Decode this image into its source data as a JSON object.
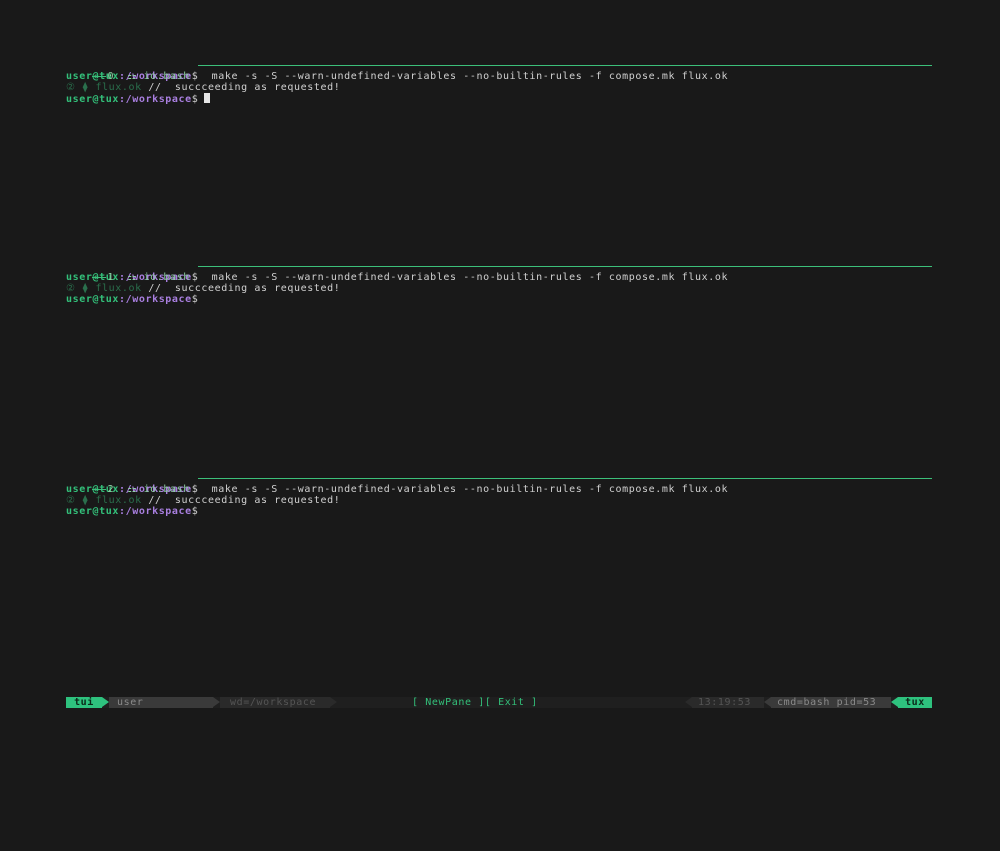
{
  "panes": [
    {
      "index": "0",
      "name": "io.bash",
      "prompt_user": "user@tux",
      "prompt_path": ":/workspace",
      "prompt_sym": "$",
      "command": "  make -s -S --warn-undefined-variables --no-builtin-rules -f compose.mk flux.ok",
      "out_marker": "② ⧫ ",
      "out_target": "flux.ok",
      "out_msg": " //  succceeding as requested!",
      "active": true
    },
    {
      "index": "1",
      "name": "io.bash",
      "prompt_user": "user@tux",
      "prompt_path": ":/workspace",
      "prompt_sym": "$",
      "command": "  make -s -S --warn-undefined-variables --no-builtin-rules -f compose.mk flux.ok",
      "out_marker": "② ⧫ ",
      "out_target": "flux.ok",
      "out_msg": " //  succceeding as requested!",
      "active": false
    },
    {
      "index": "2",
      "name": "io.bash",
      "prompt_user": "user@tux",
      "prompt_path": ":/workspace",
      "prompt_sym": "$",
      "command": "  make -s -S --warn-undefined-variables --no-builtin-rules -f compose.mk flux.ok",
      "out_marker": "② ⧫ ",
      "out_target": "flux.ok",
      "out_msg": " //  succceeding as requested!",
      "active": false
    }
  ],
  "pane_icon": "⚏",
  "statusbar": {
    "session": "tui",
    "user": "user",
    "wd": "wd=/workspace",
    "newpane": "[ NewPane ]",
    "exit": "[ Exit ]",
    "time": "13:19:53",
    "cmd": "cmd=bash pid=53",
    "host": "tux"
  },
  "colors": {
    "background": "#191919",
    "accent_green": "#2ec27e",
    "path_purple": "#a97fe0"
  }
}
